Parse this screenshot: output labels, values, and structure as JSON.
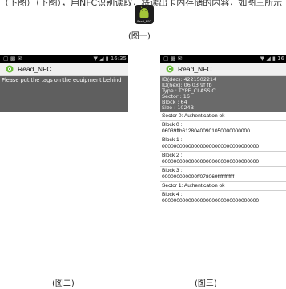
{
  "header_text": "（下图）（下图），用NFC识别读取，将读出卡内存储的内容，如图三所示（图三）。",
  "app_icon": {
    "label": "Read_NFC",
    "icon": "android-robot-icon"
  },
  "captions": {
    "fig1": "(图一)",
    "fig2": "(图二)",
    "fig3": "(图三)"
  },
  "screen2": {
    "status_left": "▢ ▩ ✉",
    "status_right": "▼ ◢ ▮ 16:35",
    "title": "Read_NFC",
    "message": "Please put the tags on the equipment behind"
  },
  "screen3": {
    "status_left": "▢ ▩ ✉",
    "status_right": "▼ ◢ ▮ 16",
    "title": "Read_NFC",
    "info": [
      "ID(dec): 4221502214",
      "ID(hex): 06 03 9f fb",
      "Type :  TYPE_CLASSIC",
      "Sector :  16",
      "Block :  64",
      "Size :  1024B"
    ],
    "log": [
      "Sector 0: Authentication ok",
      "Block 0 :",
      "06039ffb61280400901050000000000",
      "Block 1 :",
      "000000000000000000000000000000000",
      "Block 2 :",
      "000000000000000000000000000000000",
      "Block 3 :",
      "000000000000ff078069ffffffffffff",
      "Sector 1: Authentication ok",
      "Block 4 :",
      "000000000000000000000000000000000"
    ]
  },
  "colors": {
    "android_green": "#a4c639",
    "message_panel": "#5f5f5f",
    "info_panel": "#6a6a6a"
  }
}
